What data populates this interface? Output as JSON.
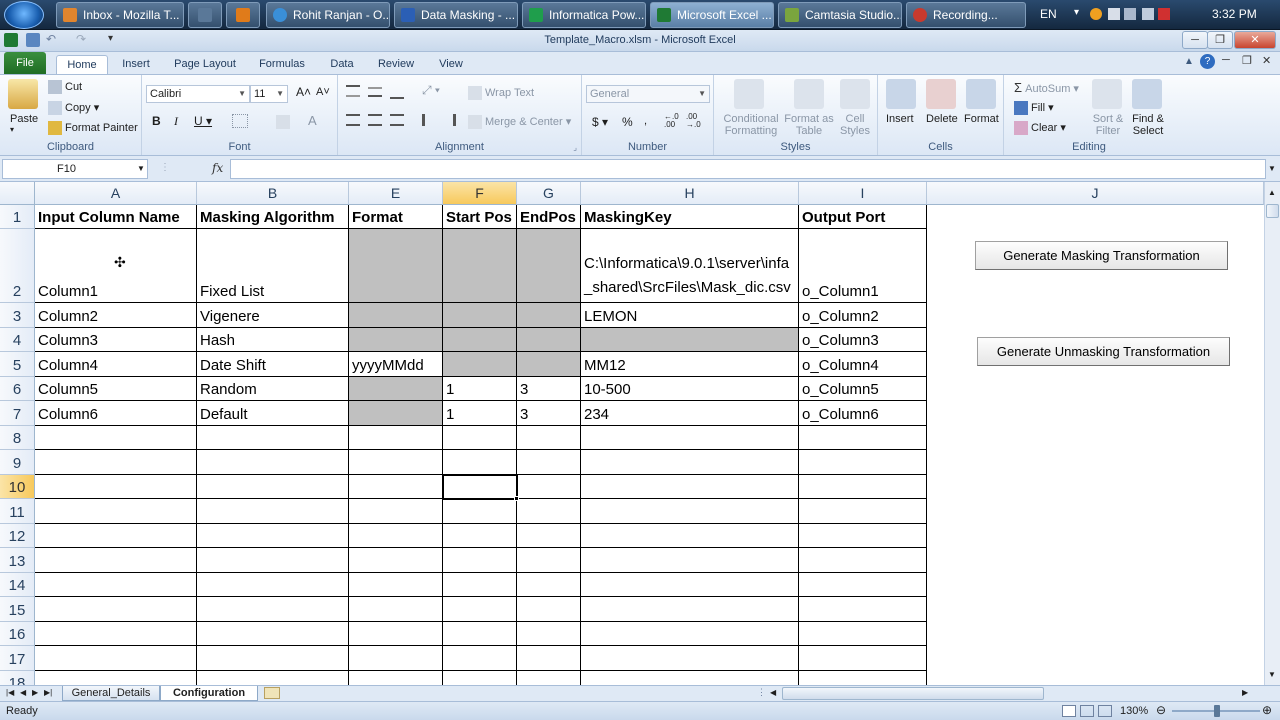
{
  "taskbar": {
    "items": [
      {
        "label": "Inbox - Mozilla T...",
        "color": "#e0852e"
      },
      {
        "label": "",
        "color": "#5a7898"
      },
      {
        "label": "",
        "color": "#e07b1a"
      },
      {
        "label": "Rohit Ranjan - O...",
        "color": "#3a8fd8"
      },
      {
        "label": "Data Masking - ...",
        "color": "#2b5fb5"
      },
      {
        "label": "Informatica Pow...",
        "color": "#1f9e4c"
      },
      {
        "label": "Microsoft Excel ...",
        "color": "#1f7a34"
      },
      {
        "label": "Camtasia Studio...",
        "color": "#7aa53e"
      },
      {
        "label": "Recording...",
        "color": "#c83a2e"
      }
    ],
    "language": "EN",
    "time": "3:32 PM"
  },
  "window": {
    "title": "Template_Macro.xlsm  -  Microsoft Excel"
  },
  "ribbon": {
    "tabs": [
      "File",
      "Home",
      "Insert",
      "Page Layout",
      "Formulas",
      "Data",
      "Review",
      "View"
    ],
    "clipboard": {
      "paste": "Paste",
      "cut": "Cut",
      "copy": "Copy",
      "format_painter": "Format Painter",
      "label": "Clipboard"
    },
    "font": {
      "name": "Calibri",
      "size": "11",
      "label": "Font"
    },
    "alignment": {
      "wrap_text": "Wrap Text",
      "merge_center": "Merge & Center",
      "label": "Alignment"
    },
    "number": {
      "format": "General",
      "label": "Number"
    },
    "styles": {
      "conditional": "Conditional Formatting",
      "format_table": "Format as Table",
      "cell_styles": "Cell Styles",
      "label": "Styles"
    },
    "cells": {
      "insert": "Insert",
      "delete": "Delete",
      "format": "Format",
      "label": "Cells"
    },
    "editing": {
      "autosum": "AutoSum",
      "fill": "Fill",
      "clear": "Clear",
      "sort_filter": "Sort & Filter",
      "find_select": "Find & Select",
      "label": "Editing"
    }
  },
  "formula_bar": {
    "name_box": "F10",
    "fx": "fx",
    "content": ""
  },
  "sheet": {
    "columns": [
      "A",
      "B",
      "E",
      "F",
      "G",
      "H",
      "I",
      "J"
    ],
    "selected_column": "F",
    "selected_row": "10",
    "rows": [
      "1",
      "2",
      "3",
      "4",
      "5",
      "6",
      "7",
      "8",
      "9",
      "10",
      "11",
      "12",
      "13",
      "14",
      "15",
      "16",
      "17",
      "18"
    ],
    "headers": [
      "Input Column Name",
      "Masking Algorithm",
      "Format",
      "Start Pos",
      "EndPos",
      "MaskingKey",
      "Output Port"
    ],
    "data": [
      [
        "Column1",
        "Fixed List",
        "",
        "",
        "",
        "C:\\Informatica\\9.0.1\\server\\infa_shared\\SrcFiles\\Mask_dic.csv",
        "o_Column1"
      ],
      [
        "Column2",
        "Vigenere",
        "",
        "",
        "",
        "LEMON",
        "o_Column2"
      ],
      [
        "Column3",
        "Hash",
        "",
        "",
        "",
        "",
        "o_Column3"
      ],
      [
        "Column4",
        "Date Shift",
        "yyyyMMdd",
        "",
        "",
        "MM12",
        "o_Column4"
      ],
      [
        "Column5",
        "Random",
        "",
        "1",
        "3",
        "10-500",
        "o_Column5"
      ],
      [
        "Column6",
        "Default",
        "",
        "1",
        "3",
        "234",
        "o_Column6"
      ]
    ],
    "buttons": {
      "generate_masking": "Generate Masking Transformation",
      "generate_unmasking": "Generate Unmasking Transformation"
    }
  },
  "sheet_tabs": [
    "General_Details",
    "Configuration"
  ],
  "active_sheet": "Configuration",
  "status": {
    "ready": "Ready",
    "zoom": "130%"
  }
}
